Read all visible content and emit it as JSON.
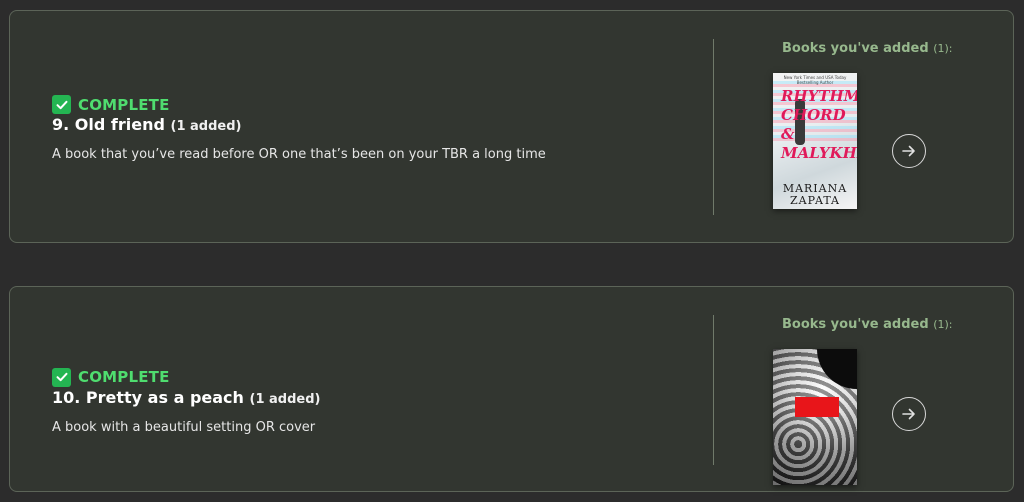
{
  "cards": [
    {
      "status": "COMPLETE",
      "title": "9. Old friend",
      "added": "(1 added)",
      "description": "A book that you’ve read before OR one that’s been on your TBR a long time",
      "books_label": "Books you've added",
      "books_count": "(1):",
      "cover": {
        "title": "RHYTHM, CHORD & MALYKHIN",
        "author": "MARIANA ZAPATA",
        "top_text": "New York Times and USA Today Bestselling Author"
      }
    },
    {
      "status": "COMPLETE",
      "title": "10. Pretty as a peach",
      "added": "(1 added)",
      "description": "A book with a beautiful setting OR cover",
      "books_label": "Books you've added",
      "books_count": "(1):",
      "cover": {}
    }
  ],
  "icons": {
    "check": "check-square-icon",
    "arrow": "arrow-right-circle-icon"
  },
  "colors": {
    "card_bg": "#323630",
    "status_green": "#4fdd6f",
    "books_label": "#97b88d"
  }
}
